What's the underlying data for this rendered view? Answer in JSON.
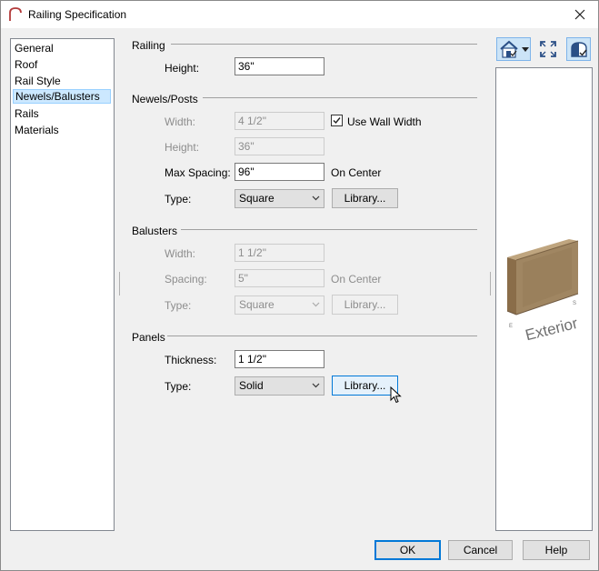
{
  "window": {
    "title": "Railing Specification"
  },
  "nav": {
    "items": [
      {
        "label": "General"
      },
      {
        "label": "Roof"
      },
      {
        "label": "Rail Style"
      },
      {
        "label": "Newels/Balusters"
      },
      {
        "label": "Rails"
      },
      {
        "label": "Materials"
      }
    ],
    "selected": "Newels/Balusters"
  },
  "railing": {
    "title": "Railing",
    "height_label": "Height:",
    "height_value": "36\""
  },
  "newels": {
    "title": "Newels/Posts",
    "width_label": "Width:",
    "width_value": "4 1/2\"",
    "use_wall_width_label": "Use Wall Width",
    "use_wall_width_checked": true,
    "height_label": "Height:",
    "height_value": "36\"",
    "max_spacing_label": "Max Spacing:",
    "max_spacing_value": "96\"",
    "on_center": "On Center",
    "type_label": "Type:",
    "type_value": "Square",
    "library_label": "Library..."
  },
  "balusters": {
    "title": "Balusters",
    "width_label": "Width:",
    "width_value": "1 1/2\"",
    "spacing_label": "Spacing:",
    "spacing_value": "5\"",
    "on_center": "On Center",
    "type_label": "Type:",
    "type_value": "Square",
    "library_label": "Library..."
  },
  "panels": {
    "title": "Panels",
    "thickness_label": "Thickness:",
    "thickness_value": "1 1/2\"",
    "type_label": "Type:",
    "type_value": "Solid",
    "library_label": "Library..."
  },
  "preview": {
    "exterior_label": "Exterior",
    "small_label_e": "E",
    "small_label_s": "S"
  },
  "footer": {
    "ok": "OK",
    "cancel": "Cancel",
    "help": "Help"
  },
  "colors": {
    "accent": "#0078d7",
    "selection": "#cce8ff",
    "rail_wood": "#a08662"
  },
  "icons": [
    "railing-app-icon",
    "close-icon",
    "view-type-icon",
    "fill-window-icon",
    "preview-toggle-icon",
    "chevron-down-icon",
    "check-icon",
    "mouse-cursor-icon"
  ]
}
